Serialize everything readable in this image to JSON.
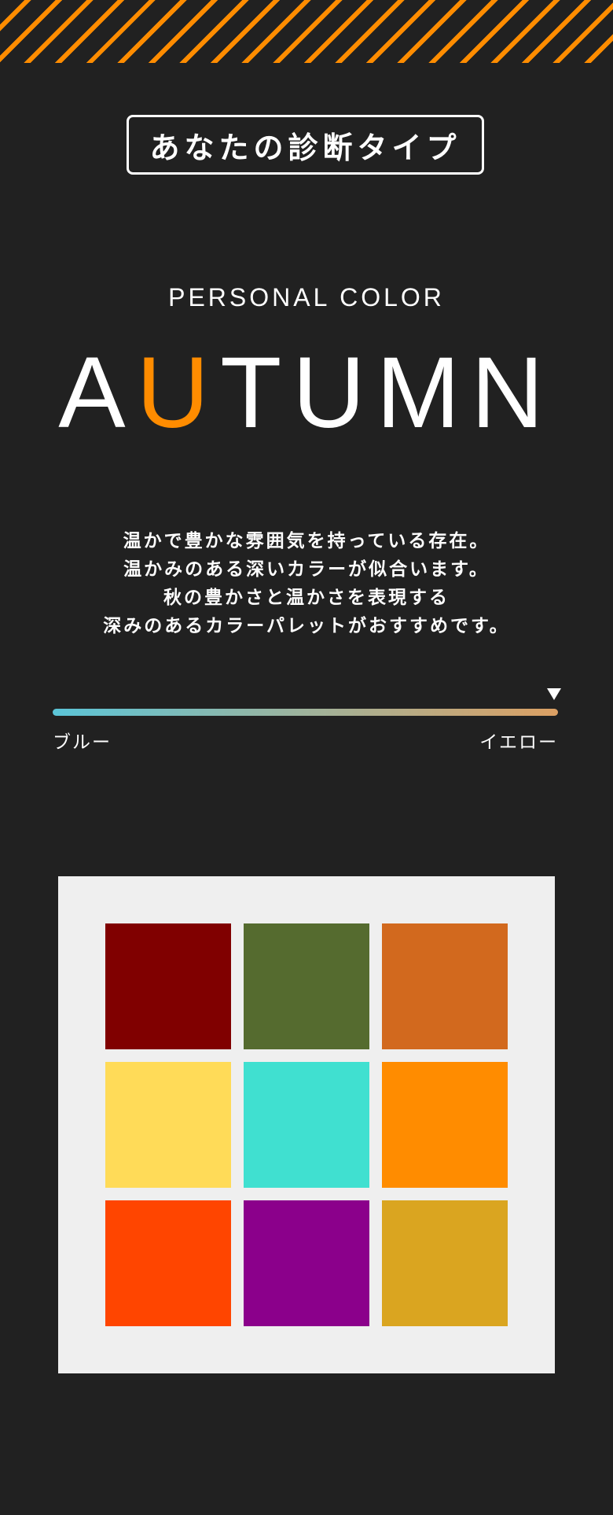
{
  "header": {
    "label": "あなたの診断タイプ"
  },
  "result": {
    "category": "PERSONAL COLOR",
    "season_letters": [
      "A",
      "U",
      "T",
      "U",
      "M",
      "N"
    ],
    "accent_index": 1,
    "accent_color": "#ff8c00"
  },
  "description": {
    "lines": [
      "温かで豊かな雰囲気を持っている存在。",
      "温かみのある深いカラーが似合います。",
      "秋の豊かさと温かさを表現する",
      "深みのあるカラーパレットがおすすめです。"
    ]
  },
  "scale": {
    "left_label": "ブルー",
    "right_label": "イエロー",
    "position": 1.0,
    "gradient_colors": [
      "#5bc5d8",
      "#dca063"
    ]
  },
  "palette": {
    "swatches": [
      {
        "name": "maroon",
        "color": "#800000"
      },
      {
        "name": "dark-olive-green",
        "color": "#556b2f"
      },
      {
        "name": "chocolate",
        "color": "#d2691e"
      },
      {
        "name": "mustard-yellow",
        "color": "#ffdb58"
      },
      {
        "name": "turquoise",
        "color": "#40e0d0"
      },
      {
        "name": "dark-orange",
        "color": "#ff8c00"
      },
      {
        "name": "orange-red",
        "color": "#ff4500"
      },
      {
        "name": "dark-magenta",
        "color": "#8b008b"
      },
      {
        "name": "goldenrod",
        "color": "#daa520"
      }
    ]
  },
  "colors": {
    "background": "#212121",
    "accent": "#ff8c00",
    "card": "#efefef",
    "text": "#ffffff"
  }
}
